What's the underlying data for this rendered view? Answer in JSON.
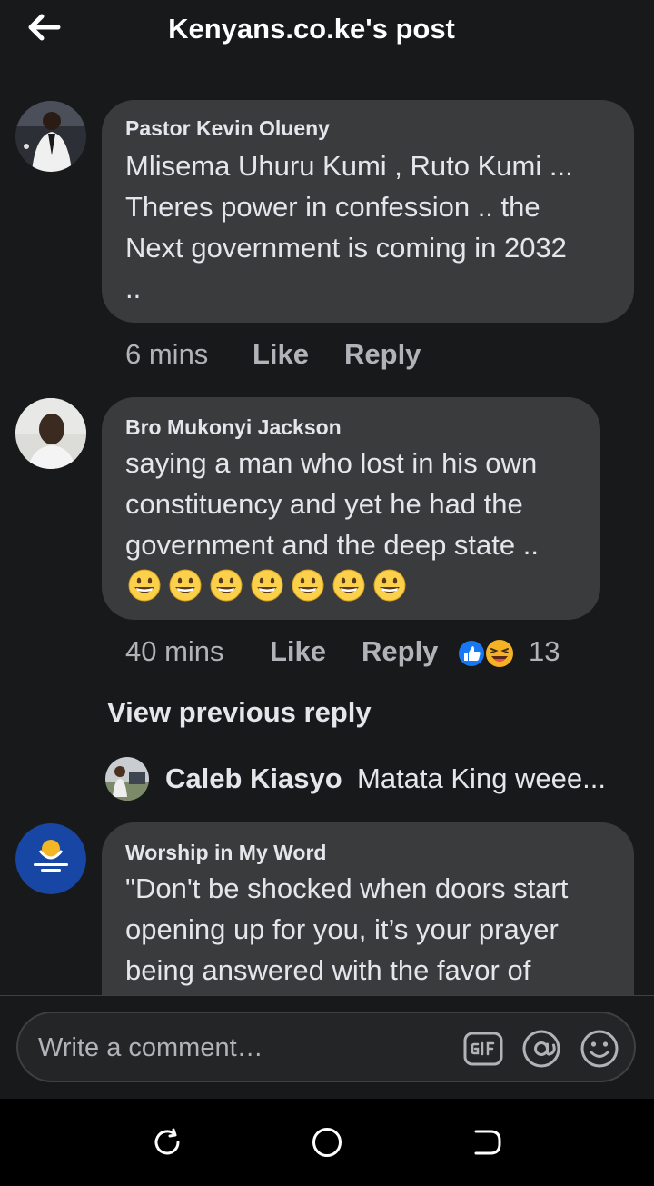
{
  "header": {
    "title": "Kenyans.co.ke's post",
    "back_icon": "arrow-left-icon"
  },
  "comments": [
    {
      "author": "Pastor Kevin Olueny",
      "lines": [
        "Mlisema Uhuru Kumi , Ruto Kumi ...",
        "Theres power in confession .. the",
        "Next government is coming in 2032",
        ".."
      ],
      "time": "6 mins",
      "like_label": "Like",
      "reply_label": "Reply"
    },
    {
      "author": "Bro Mukonyi Jackson",
      "lines": [
        "saying a man who lost in his own",
        "constituency and yet he had the",
        "government and the deep state .."
      ],
      "emoji": "grinning-face-emoji",
      "emoji_count": 7,
      "time": "40 mins",
      "like_label": "Like",
      "reply_label": "Reply",
      "reaction_icons": [
        "like-reaction-icon",
        "laughing-reaction-icon"
      ],
      "reaction_count": "13"
    },
    {
      "author": "Worship in My Word",
      "lines": [
        "\"Don't be shocked when doors start",
        "opening up for you, it’s your prayer",
        "being answered with the favor of"
      ]
    }
  ],
  "view_previous_reply": "View previous reply",
  "reply_preview": {
    "author": "Caleb Kiasyo",
    "text": "Matata King weee..."
  },
  "composer": {
    "placeholder": "Write a comment…",
    "icons": [
      "gif-icon",
      "mention-icon",
      "emoji-picker-icon"
    ]
  },
  "android_nav": {
    "icons": [
      "recent-apps-icon",
      "home-icon",
      "back-icon"
    ]
  },
  "colors": {
    "background": "#18191a",
    "bubble": "#3a3b3c",
    "secondary_text": "#b0b3b8",
    "like_blue": "#1877f2",
    "worship_avatar": "#1846a4"
  }
}
